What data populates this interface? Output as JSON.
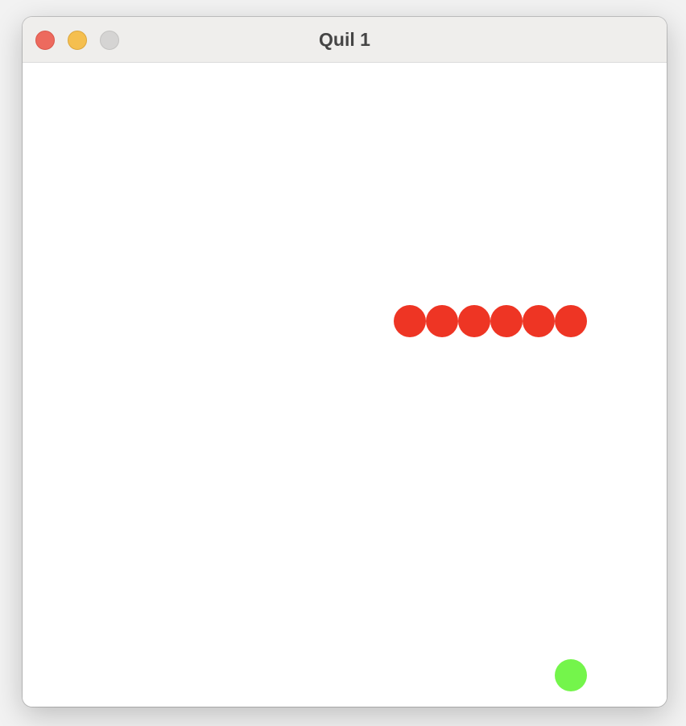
{
  "window": {
    "title": "Quil 1",
    "controls": {
      "close_color": "#ed6a5e",
      "minimize_color": "#f5bf4f",
      "zoom_color": "#d5d4d3"
    }
  },
  "game": {
    "snake": {
      "color": "#ee3524",
      "segments": 6
    },
    "food": {
      "color": "#74f54b"
    }
  }
}
